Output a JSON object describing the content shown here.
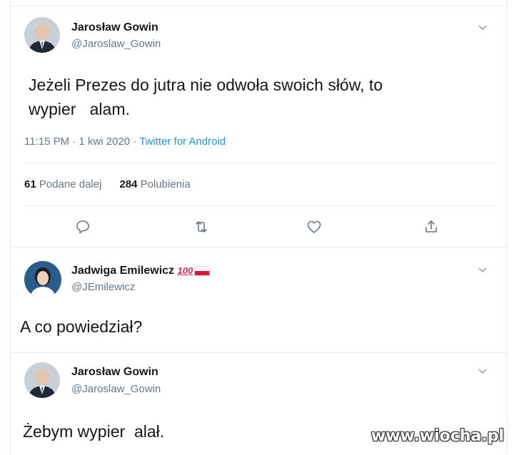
{
  "tweet1": {
    "name": "Jarosław Gowin",
    "handle": "@Jaroslaw_Gowin",
    "text_line1": "Jeżeli Prezes do jutra nie odwoła swoich słów, to",
    "text_line2_a": "wypier",
    "text_line2_b": "alam.",
    "time": "11:15 PM · 1 kwi 2020 · ",
    "source": "Twitter for Android",
    "retweets_count": "61",
    "retweets_label": "Podane dalej",
    "likes_count": "284",
    "likes_label": "Polubienia",
    "actions": [
      "reply-icon",
      "retweet-icon",
      "like-icon",
      "share-icon"
    ]
  },
  "tweet2": {
    "name": "Jadwiga Emilewicz",
    "badge_100": "100",
    "handle": "@JEmilewicz",
    "text": "A co powiedział?"
  },
  "tweet3": {
    "name": "Jarosław Gowin",
    "handle": "@Jaroslaw_Gowin",
    "text_a": "Żebym wypier",
    "text_b": "alał."
  },
  "watermark": "www.wiocha.pl",
  "colors": {
    "link": "#1b95e0",
    "secondary": "#657786",
    "divider": "#e6ecf0"
  }
}
